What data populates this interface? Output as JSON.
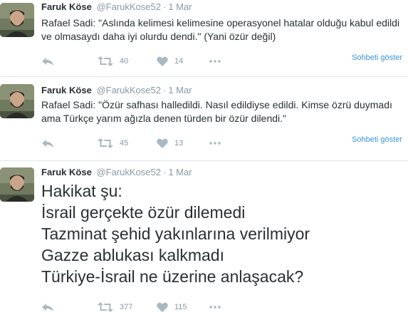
{
  "tweets": [
    {
      "author_name": "Faruk Köse",
      "handle": "@FarukKose52",
      "separator": "·",
      "time": "1 Mar",
      "text": "Rafael Sadi: \"Aslında kelimesi kelimesine operasyonel hatalar olduğu kabul edildi ve olmasaydı daha iyi olurdu dendi.\" (Yani özür değil)",
      "retweets": "40",
      "likes": "14",
      "conversation_link": "Sohbeti göster"
    },
    {
      "author_name": "Faruk Köse",
      "handle": "@FarukKose52",
      "separator": "·",
      "time": "1 Mar",
      "text": "Rafael Sadi: \"Özür safhası halledildi. Nasıl edildiyse edildi. Kimse özrü duymadı ama Türkçe yarım ağızla denen türden bir özür dilendi.\"",
      "retweets": "45",
      "likes": "13",
      "conversation_link": "Sohbeti göster"
    },
    {
      "author_name": "Faruk Köse",
      "handle": "@FarukKose52",
      "separator": "·",
      "time": "1 Mar",
      "text": "Hakikat şu:\nİsrail gerçekte özür dilemedi\nTazminat şehid yakınlarına verilmiyor\nGazze ablukası kalkmadı\nTürkiye-İsrail ne üzerine anlaşacak?",
      "retweets": "377",
      "likes": "115"
    }
  ],
  "icons": {
    "reply": "reply-icon",
    "retweet": "retweet-icon",
    "like": "heart-icon",
    "more": "more-icon"
  },
  "colors": {
    "link": "#3b94d9",
    "muted": "#8899a6",
    "icon": "#aab8c2",
    "text": "#292f33",
    "divider": "#e1e8ed"
  }
}
